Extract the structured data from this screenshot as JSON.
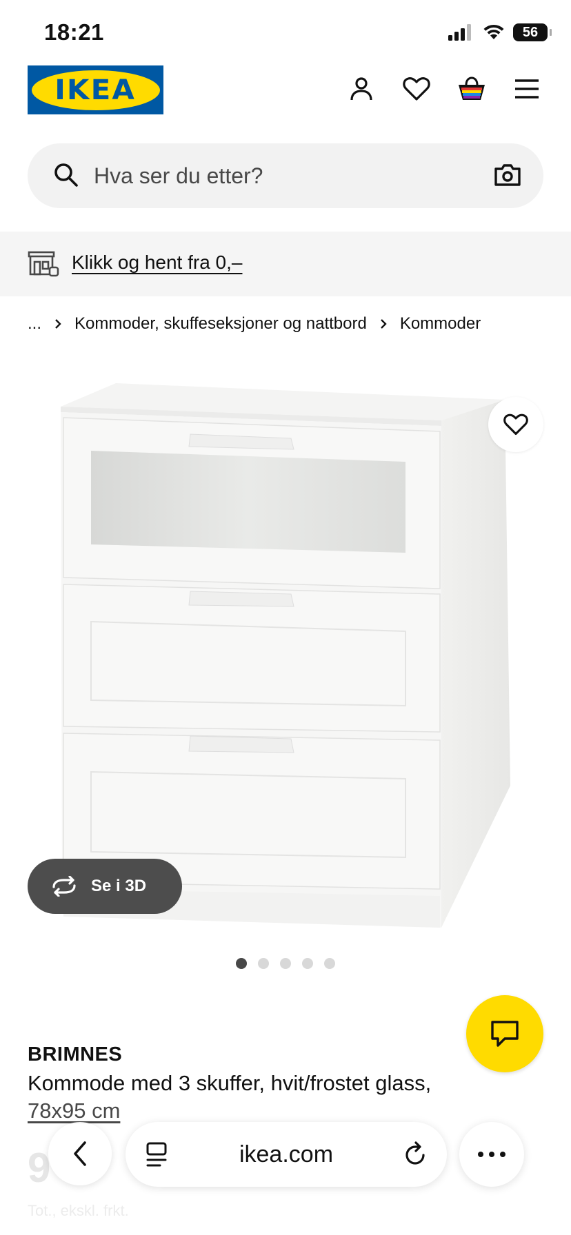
{
  "status_bar": {
    "time": "18:21",
    "battery": "56",
    "icons": [
      "signal-icon",
      "wifi-icon",
      "battery-icon"
    ]
  },
  "header": {
    "logo_text": "IKEA",
    "icons": [
      "user-icon",
      "heart-icon",
      "basket-icon",
      "menu-icon"
    ]
  },
  "search": {
    "placeholder": "Hva ser du etter?",
    "value": ""
  },
  "promo": {
    "link_text": "Klikk og hent fra 0,–"
  },
  "breadcrumb": {
    "ellipsis": "...",
    "items": [
      "Kommoder, skuffeseksjoner og nattbord",
      "Kommoder"
    ]
  },
  "product": {
    "view_3d_label": "Se i 3D",
    "image_count": 5,
    "active_image": 1,
    "brand": "BRIMNES",
    "description": "Kommode med 3 skuffer, hvit/frostet glass,",
    "size": "78x95 cm",
    "price_partial": "9",
    "price_sub": "Tot., ekskl. frkt."
  },
  "browser": {
    "url": "ikea.com"
  },
  "colors": {
    "ikea_blue": "#0058a3",
    "ikea_yellow": "#ffdb00",
    "dark_button": "#4d4d4d"
  }
}
